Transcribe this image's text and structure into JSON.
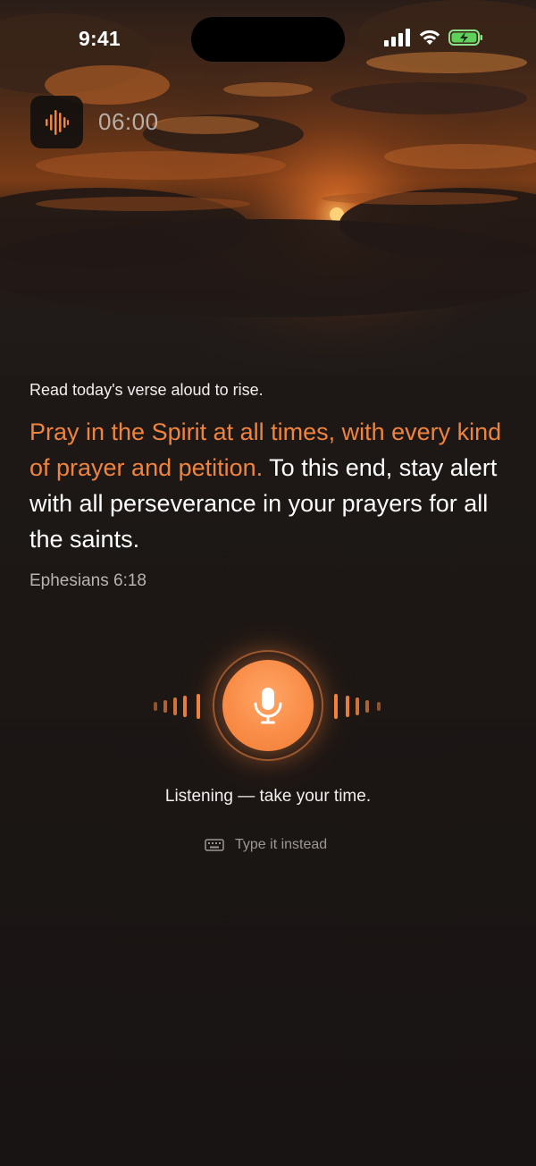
{
  "status_bar": {
    "time": "9:41"
  },
  "timer": {
    "icon": "waveform-icon",
    "value": "06:00"
  },
  "verse_card": {
    "instruction": "Read today's verse aloud to rise.",
    "highlighted_text": "Pray in the Spirit at all times, with every kind of prayer and petition.",
    "remaining_text": " To this end, stay alert with all perseverance in your prayers for all the saints.",
    "reference": "Ephesians 6:18"
  },
  "voice_input": {
    "icon": "microphone-icon",
    "status": "Listening — take your time.",
    "alternate_label": "Type it instead",
    "alternate_icon": "keyboard-icon"
  },
  "colors": {
    "accent": "#f0843f",
    "background": "#1c1715"
  }
}
